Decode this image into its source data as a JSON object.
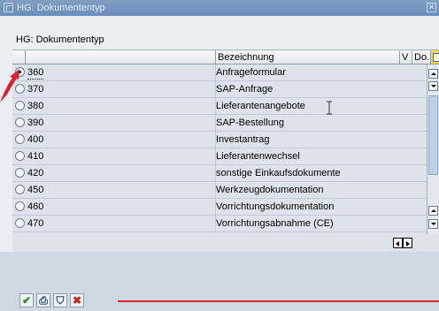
{
  "window": {
    "title": "HG: Dokumententyp",
    "close_glyph": "✕"
  },
  "table": {
    "caption": "HG: Dokumententyp",
    "columns": {
      "bezeichnung": "Bezeichnung",
      "v": "V",
      "do": "Do.."
    },
    "rows": [
      {
        "code": "360",
        "label": "Anfrageformular",
        "selected": true
      },
      {
        "code": "370",
        "label": "SAP-Anfrage",
        "selected": false
      },
      {
        "code": "380",
        "label": "Lieferantenangebote",
        "selected": false
      },
      {
        "code": "390",
        "label": "SAP-Bestellung",
        "selected": false
      },
      {
        "code": "400",
        "label": "Investantrag",
        "selected": false
      },
      {
        "code": "410",
        "label": "Lieferantenwechsel",
        "selected": false
      },
      {
        "code": "420",
        "label": "sonstige Einkaufsdokumente",
        "selected": false
      },
      {
        "code": "450",
        "label": "Werkzeugdokumentation",
        "selected": false
      },
      {
        "code": "460",
        "label": "Vorrichtungsdokumentation",
        "selected": false
      },
      {
        "code": "470",
        "label": "Vorrichtungsabnahme (CE)",
        "selected": false
      }
    ]
  },
  "toolbar": {
    "confirm_glyph": "✔",
    "print_glyph": "⎙",
    "filter_glyph": "⛉",
    "cancel_glyph": "✖"
  },
  "colors": {
    "annotation_red": "#d8252b",
    "title_bar": "#6a8db7"
  }
}
